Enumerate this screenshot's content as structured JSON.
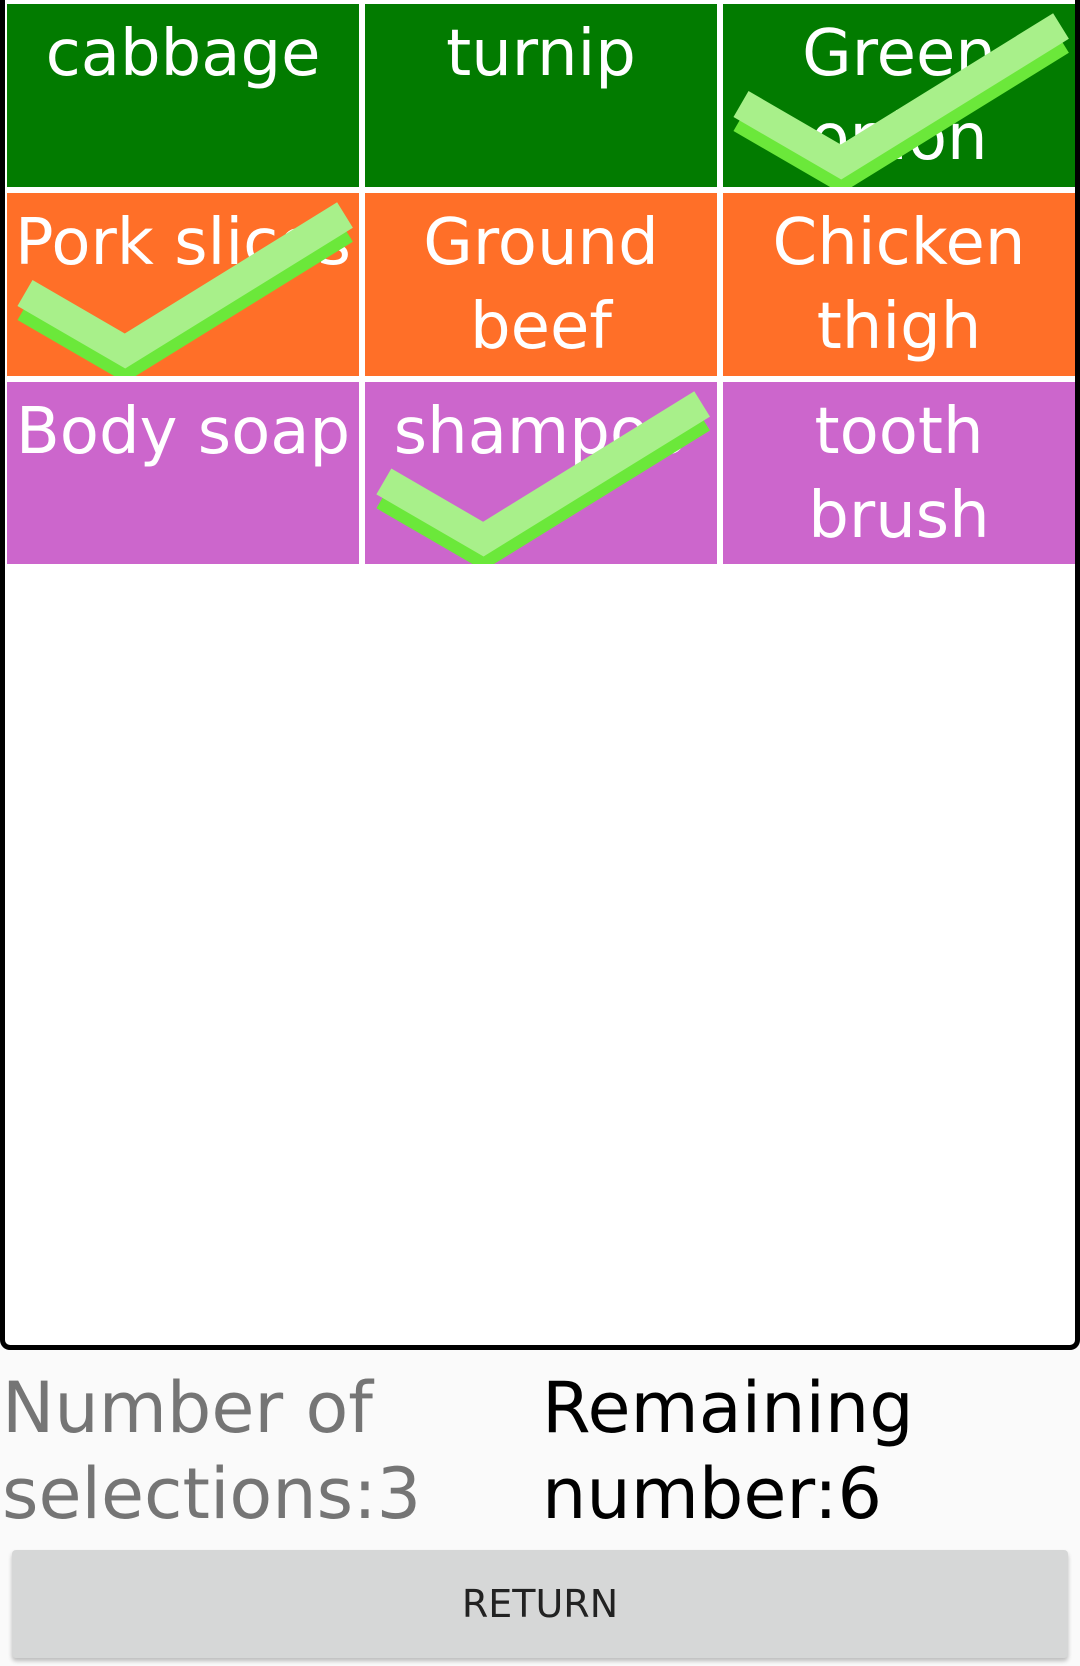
{
  "items": [
    {
      "label": "cabbage",
      "color": "#027b00",
      "checked": false
    },
    {
      "label": "turnip",
      "color": "#027b00",
      "checked": false
    },
    {
      "label": "Green onion",
      "color": "#027b00",
      "checked": true
    },
    {
      "label": "Pork slices",
      "color": "#ff6f28",
      "checked": true
    },
    {
      "label": "Ground beef",
      "color": "#ff6f28",
      "checked": false
    },
    {
      "label": "Chicken thigh",
      "color": "#ff6f28",
      "checked": false
    },
    {
      "label": "Body soap",
      "color": "#cc66cc",
      "checked": false
    },
    {
      "label": "shampoo",
      "color": "#cc66cc",
      "checked": true
    },
    {
      "label": "tooth brush",
      "color": "#cc66cc",
      "checked": false
    }
  ],
  "check_icon": "checkmark-icon",
  "check_colors": {
    "front": "#a8f08a",
    "back": "#6be83a"
  },
  "stats": {
    "selections": "Number of selections:3",
    "remaining": "Remaining number:6"
  },
  "return_button": "RETURN"
}
